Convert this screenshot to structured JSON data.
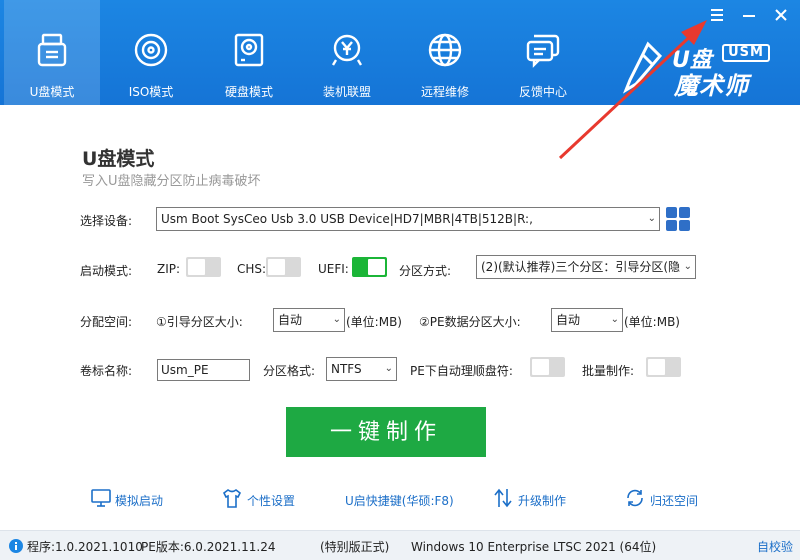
{
  "nav": {
    "items": [
      {
        "label": "U盘模式",
        "icon": "usb-drive-icon"
      },
      {
        "label": "ISO模式",
        "icon": "disc-icon"
      },
      {
        "label": "硬盘模式",
        "icon": "hard-disk-icon"
      },
      {
        "label": "装机联盟",
        "icon": "yen-coin-icon"
      },
      {
        "label": "远程维修",
        "icon": "globe-icon"
      },
      {
        "label": "反馈中心",
        "icon": "chat-icon"
      }
    ],
    "active_index": 0
  },
  "logo": {
    "usm": "USM",
    "u": "U盘",
    "main": "魔术师"
  },
  "window": {
    "menu_icon": "menu-icon",
    "minimize_icon": "minimize-icon",
    "close_icon": "close-icon"
  },
  "page": {
    "title": "U盘模式",
    "subtitle": "写入U盘隐藏分区防止病毒破坏"
  },
  "device": {
    "label": "选择设备:",
    "selected": "Usm Boot SysCeo Usb 3.0 USB Device|HD7|MBR|4TB|512B|R:,"
  },
  "boot_mode": {
    "label": "启动模式:",
    "zip_label": "ZIP:",
    "zip_on": false,
    "chs_label": "CHS:",
    "chs_on": false,
    "uefi_label": "UEFI:",
    "uefi_on": true,
    "partition_mode_label": "分区方式:",
    "partition_mode_value": "(2)(默认推荐)三个分区：引导分区(隐"
  },
  "space": {
    "label": "分配空间:",
    "boot_size_label": "①引导分区大小:",
    "boot_size_value": "自动",
    "boot_unit": "(单位:MB)",
    "pe_size_label": "②PE数据分区大小:",
    "pe_size_value": "自动",
    "pe_unit": "(单位:MB)"
  },
  "volume": {
    "label": "卷标名称:",
    "value": "Usm_PE",
    "format_label": "分区格式:",
    "format_value": "NTFS",
    "pe_auto_label": "PE下自动理顺盘符:",
    "pe_auto_on": false,
    "batch_label": "批量制作:",
    "batch_on": false
  },
  "make_button": "一键制作",
  "tools": [
    {
      "label": "模拟启动",
      "icon": "monitor-icon"
    },
    {
      "label": "个性设置",
      "icon": "shirt-icon"
    },
    {
      "label": "U启快捷键(华硕:F8)",
      "icon": ""
    },
    {
      "label": "升级制作",
      "icon": "upgrade-arrows-icon"
    },
    {
      "label": "归还空间",
      "icon": "refresh-icon"
    }
  ],
  "status": {
    "program": "程序:1.0.2021.1010",
    "pe_version": "PE版本:6.0.2021.11.24",
    "edition": "(特别版正式)",
    "os": "Windows 10 Enterprise LTSC 2021 (64位)",
    "verify": "自校验"
  },
  "colors": {
    "header": "#1574d6",
    "make_button": "#1ea943",
    "toggle_on": "#1bb537",
    "link": "#1c6fc8",
    "arrow": "#e8392e"
  }
}
